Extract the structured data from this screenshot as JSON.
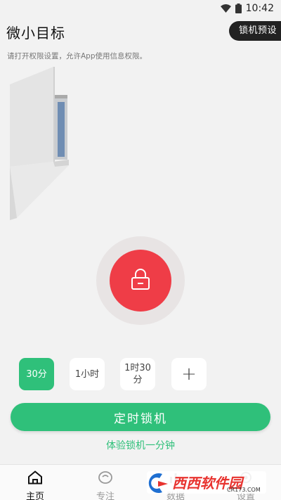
{
  "status_bar": {
    "time": "10:42"
  },
  "header": {
    "title": "微小目标",
    "preset_button": "锁机预设"
  },
  "permission_hint": "请打开权限设置，允许App使用信息权限。",
  "lock_button": {
    "icon": "padlock-icon",
    "color": "#ef3d47"
  },
  "durations": [
    {
      "label": "30分",
      "selected": true
    },
    {
      "label": "1小时",
      "selected": false
    },
    {
      "label_line1": "1时30",
      "label_line2": "分",
      "selected": false
    },
    {
      "label": "+",
      "selected": false
    }
  ],
  "start_button": "定时锁机",
  "trial_link": "体验锁机一分钟",
  "tabs": [
    {
      "label": "主页",
      "icon": "home-icon",
      "active": true
    },
    {
      "label": "专注",
      "icon": "focus-icon",
      "active": false
    },
    {
      "label": "数据",
      "icon": "data-icon",
      "active": false
    },
    {
      "label": "设置",
      "icon": "settings-icon",
      "active": false
    }
  ],
  "watermark": {
    "brand": "西西软件园",
    "site": "CR173.COM"
  },
  "colors": {
    "accent": "#2fc07a",
    "lock_red": "#ef3d47",
    "background": "#f2f2f2"
  }
}
